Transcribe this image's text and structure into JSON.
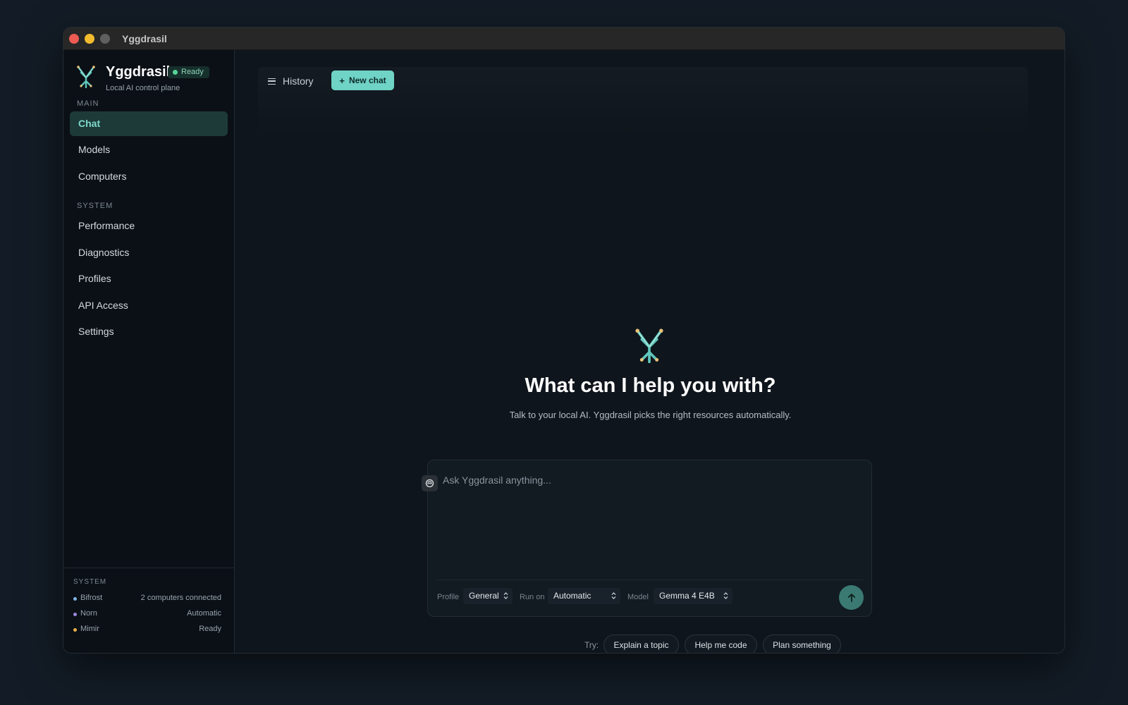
{
  "window": {
    "title": "Yggdrasil"
  },
  "sidebar": {
    "brand": {
      "name": "Yggdrasil",
      "status": "Ready",
      "subtitle": "Local AI control plane"
    },
    "sections": {
      "main": "MAIN",
      "system": "SYSTEM"
    },
    "main_items": [
      {
        "label": "Chat",
        "active": true
      },
      {
        "label": "Models"
      },
      {
        "label": "Computers"
      }
    ],
    "system_items": [
      {
        "label": "Performance"
      },
      {
        "label": "Diagnostics"
      },
      {
        "label": "Profiles"
      },
      {
        "label": "API Access"
      },
      {
        "label": "Settings"
      }
    ],
    "footer": {
      "label": "SYSTEM",
      "rows": [
        {
          "name": "Bifrost",
          "value": "2 computers connected",
          "color": "#7fb3e6"
        },
        {
          "name": "Norn",
          "value": "Automatic",
          "color": "#9c88e0"
        },
        {
          "name": "Mimir",
          "value": "Ready",
          "color": "#e8b04a"
        }
      ]
    }
  },
  "topbar": {
    "history_label": "History",
    "new_chat_label": "New chat"
  },
  "hero": {
    "title": "What can I help you with?",
    "subtitle": "Talk to your local AI. Yggdrasil picks the right resources automatically."
  },
  "composer": {
    "placeholder": "Ask Yggdrasil anything...",
    "profile_label": "Profile",
    "profile_value": "General",
    "run_on_label": "Run on",
    "run_on_value": "Automatic",
    "model_label": "Model",
    "model_value": "Gemma 4 E4B"
  },
  "suggestions": {
    "label": "Try:",
    "chips": [
      "Explain a topic",
      "Help me code",
      "Plan something"
    ]
  },
  "colors": {
    "accent": "#6fd3c6",
    "active_nav_bg": "#1d3a38",
    "send": "#3a7a72"
  }
}
